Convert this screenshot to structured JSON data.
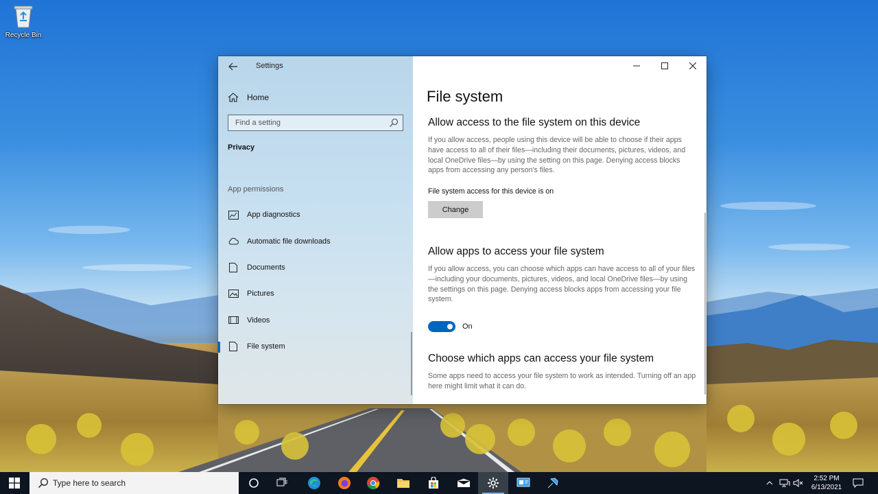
{
  "desktop": {
    "icons": [
      {
        "label": "Recycle Bin",
        "icon": "recycle-bin-icon"
      }
    ]
  },
  "window": {
    "app_title": "Settings",
    "sidebar": {
      "home_label": "Home",
      "search_placeholder": "Find a setting",
      "section": "Privacy",
      "group": "App permissions",
      "items": [
        {
          "label": "App diagnostics",
          "icon": "diagnostics-icon"
        },
        {
          "label": "Automatic file downloads",
          "icon": "cloud-icon"
        },
        {
          "label": "Documents",
          "icon": "document-icon"
        },
        {
          "label": "Pictures",
          "icon": "picture-icon"
        },
        {
          "label": "Videos",
          "icon": "video-icon"
        },
        {
          "label": "File system",
          "icon": "file-icon",
          "active": true
        }
      ]
    },
    "content": {
      "title": "File system",
      "device_access": {
        "heading": "Allow access to the file system on this device",
        "description": "If you allow access, people using this device will be able to choose if their apps have access to all of their files—including their documents, pictures, videos, and local OneDrive files—by using the setting on this page. Denying access blocks apps from accessing any person's files.",
        "status": "File system access for this device is on",
        "button_label": "Change"
      },
      "app_access": {
        "heading": "Allow apps to access your file system",
        "description": "If you allow access, you can choose which apps can have access to all of your files—including your documents, pictures, videos, and local OneDrive files—by using the settings on this page. Denying access blocks apps from accessing your file system.",
        "toggle_state": "On"
      },
      "choose_apps": {
        "heading": "Choose which apps can access your file system",
        "description": "Some apps need to access your file system to work as intended. Turning off an app here might limit what it can do."
      }
    }
  },
  "taskbar": {
    "search_placeholder": "Type here to search",
    "time": "2:52 PM",
    "date": "6/13/2021"
  },
  "colors": {
    "accent": "#0067c0",
    "taskbar": "#0c1520"
  }
}
